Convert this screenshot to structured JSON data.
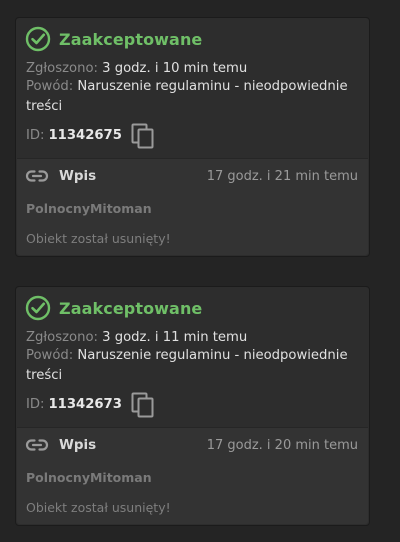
{
  "reports": [
    {
      "status": "Zaakceptowane",
      "submitted_label": "Zgłoszono:",
      "submitted_value": "3 godz. i 10 min temu",
      "reason_label": "Powód:",
      "reason_value": "Naruszenie regulaminu - nieodpowiednie treści",
      "id_label": "ID:",
      "id_value": "11342675",
      "item": {
        "type": "Wpis",
        "time": "17 godz. i 21 min temu",
        "author": "PolnocnyMitoman",
        "message": "Obiekt został usunięty!"
      }
    },
    {
      "status": "Zaakceptowane",
      "submitted_label": "Zgłoszono:",
      "submitted_value": "3 godz. i 11 min temu",
      "reason_label": "Powód:",
      "reason_value": "Naruszenie regulaminu - nieodpowiednie treści",
      "id_label": "ID:",
      "id_value": "11342673",
      "item": {
        "type": "Wpis",
        "time": "17 godz. i 20 min temu",
        "author": "PolnocnyMitoman",
        "message": "Obiekt został usunięty!"
      }
    }
  ],
  "colors": {
    "accepted": "#6fbf67",
    "background": "#242424",
    "card": "#2d2d2d",
    "sub_card": "#333333"
  },
  "icons": {
    "status": "check-circle-icon",
    "copy": "copy-icon",
    "link": "link-icon"
  }
}
